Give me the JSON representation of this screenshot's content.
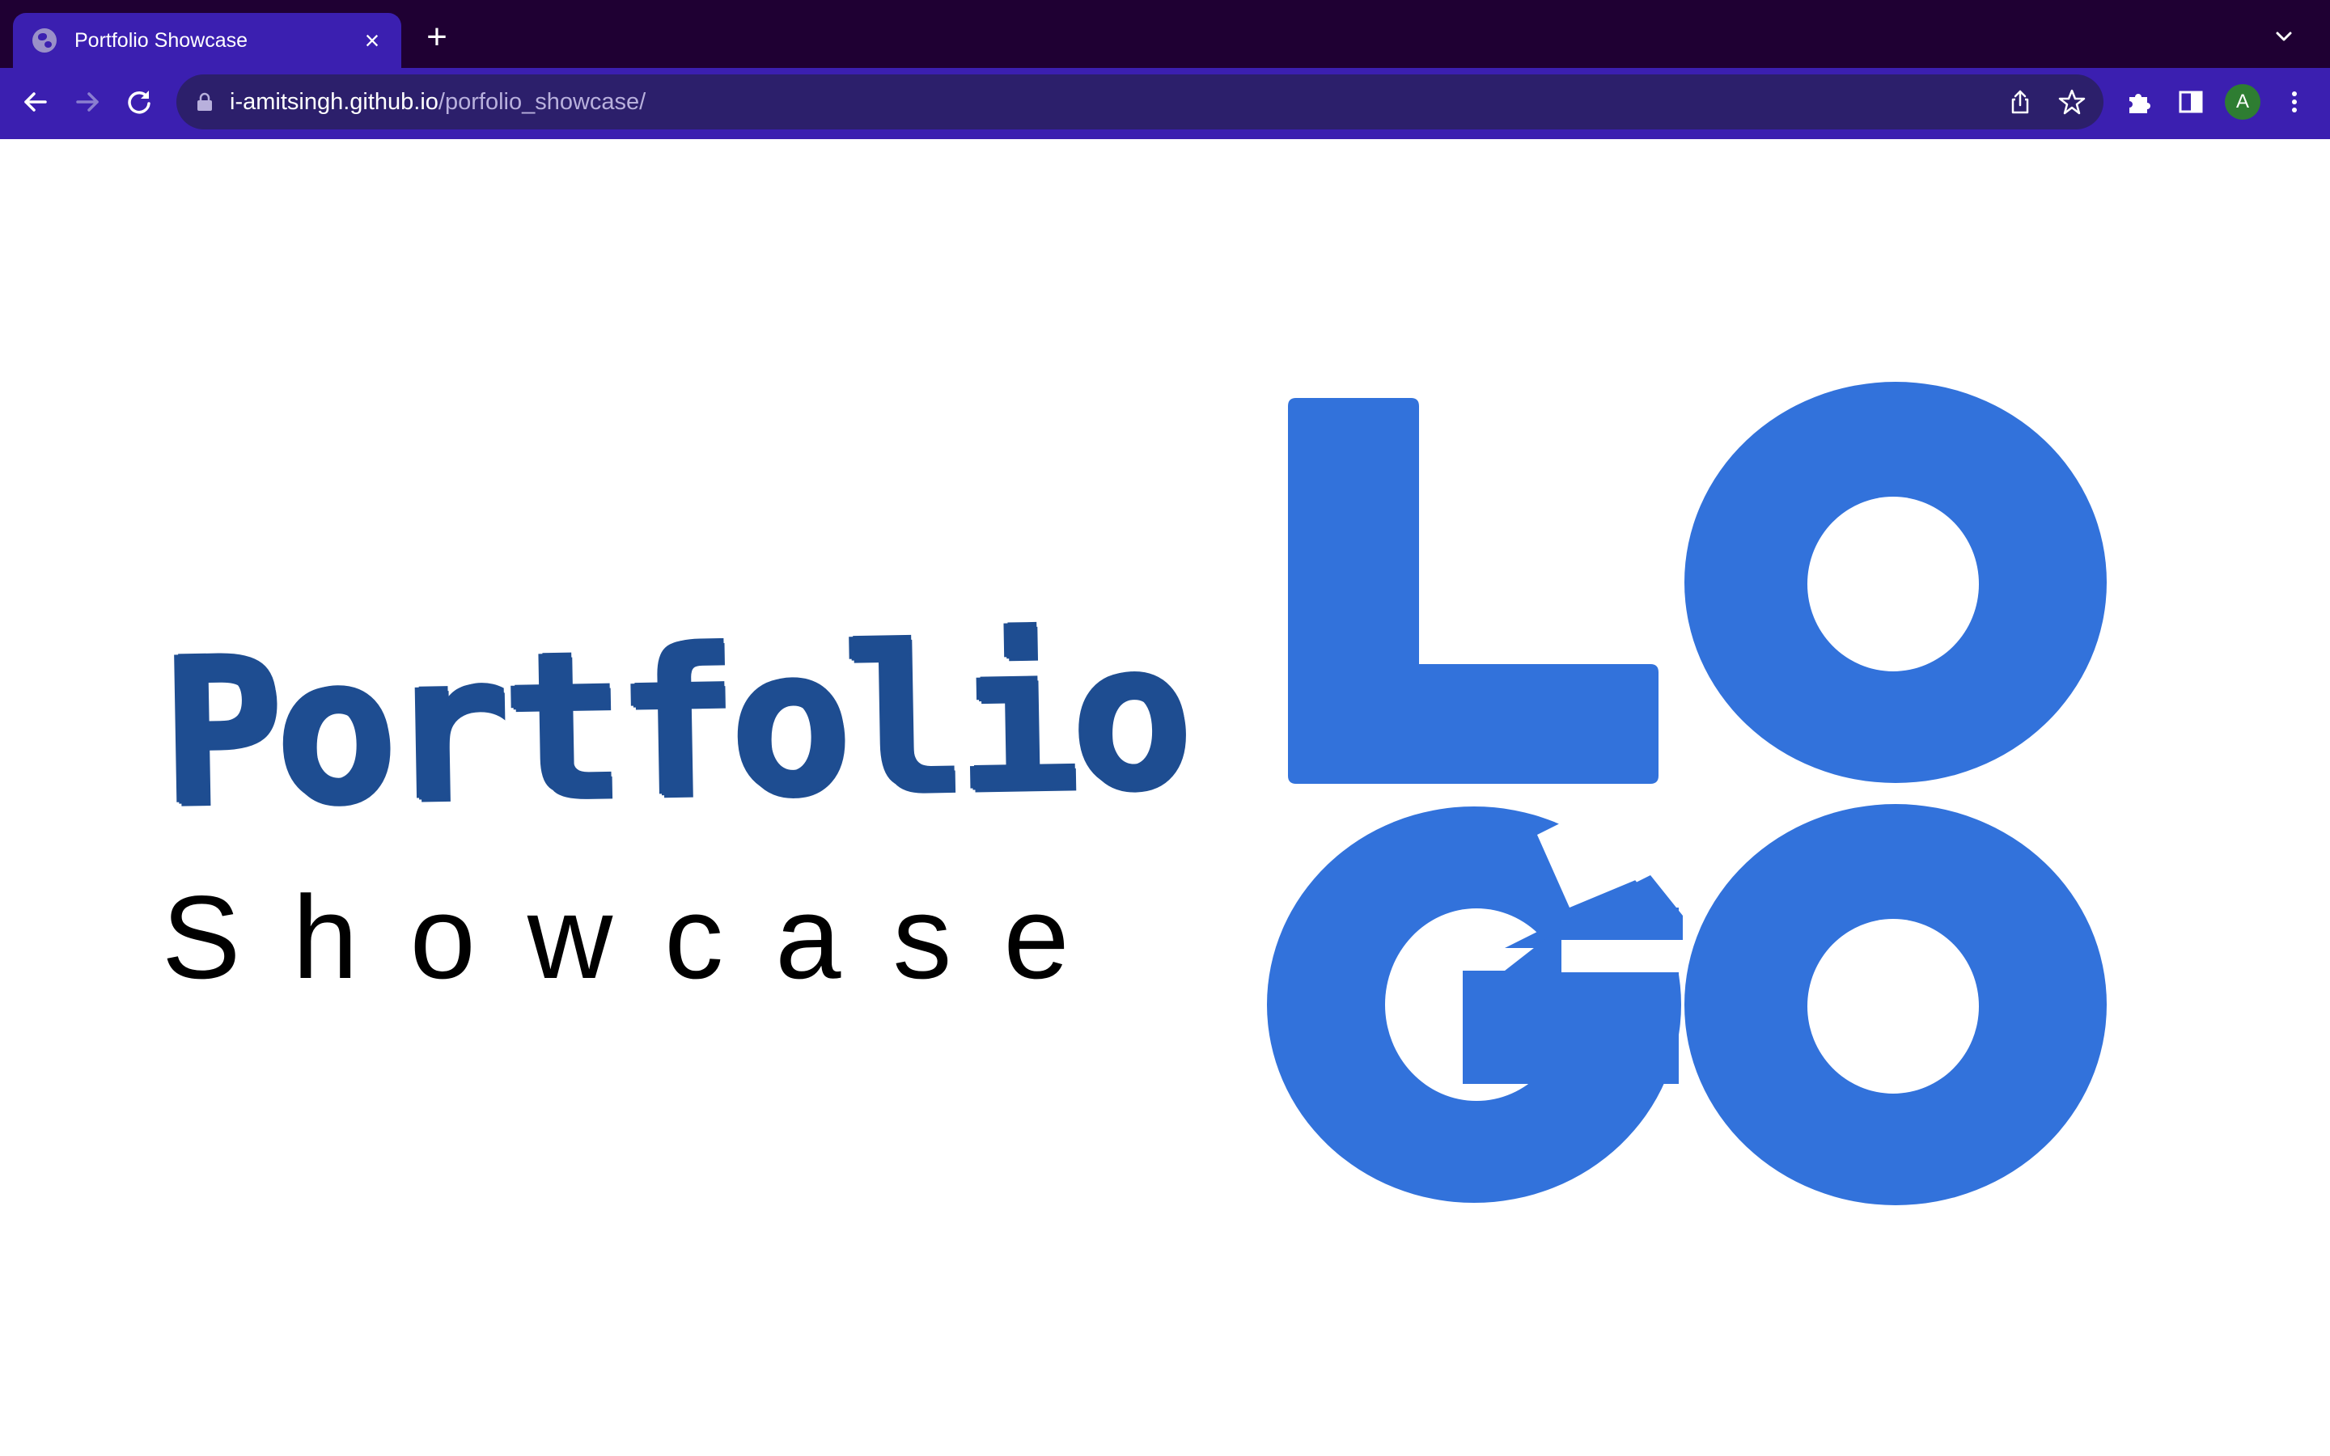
{
  "browser": {
    "tab": {
      "title": "Portfolio Showcase",
      "favicon_icon": "globe-icon",
      "close_icon": "close-icon",
      "close_label": "×"
    },
    "new_tab_label": "+",
    "tab_list_icon": "chevron-down-icon",
    "toolbar": {
      "back_icon": "arrow-left-icon",
      "forward_icon": "arrow-right-icon",
      "reload_icon": "reload-icon",
      "omnibox": {
        "lock_icon": "lock-icon",
        "url_host": "i-amitsingh.github.io",
        "url_path": "/porfolio_showcase/",
        "share_icon": "share-icon",
        "bookmark_icon": "star-icon"
      },
      "extensions_icon": "puzzle-icon",
      "side_panel_icon": "side-panel-icon",
      "profile_initial": "A",
      "menu_icon": "kebab-menu-icon"
    },
    "colors": {
      "tabstrip_bg": "#1f0033",
      "toolbar_bg": "#3b1fb0",
      "omnibox_bg": "#2c1f6b",
      "avatar_bg": "#2e7d32"
    }
  },
  "page": {
    "hero": {
      "title": "Portfolio",
      "subtitle": "Showcase"
    },
    "logo": {
      "letters": [
        "L",
        "O",
        "G",
        "O"
      ],
      "color": "#3272db"
    },
    "colors": {
      "title": "#1e4d91",
      "subtitle": "#000000",
      "background": "#ffffff"
    }
  }
}
